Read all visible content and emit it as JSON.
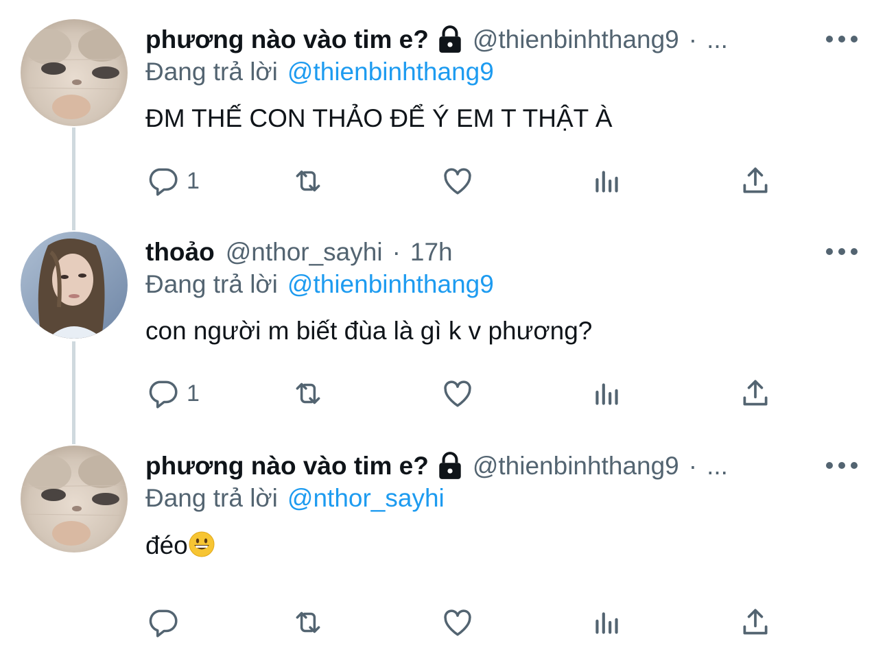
{
  "thread": [
    {
      "author_name": "phương nào vào tim e?",
      "protected": true,
      "handle": "@thienbinhthang9",
      "separator": "·",
      "time": "...",
      "reply_prefix": "Đang trả lời",
      "reply_mention": "@thienbinhthang9",
      "text": "ĐM THẾ CON THẢO ĐỂ Ý EM T THẬT À",
      "emoji": "",
      "reply_count": "1",
      "avatar": "cat-avatar"
    },
    {
      "author_name": "thoảo",
      "protected": false,
      "handle": "@nthor_sayhi",
      "separator": "·",
      "time": "17h",
      "reply_prefix": "Đang trả lời",
      "reply_mention": "@thienbinhthang9",
      "text": "con người m biết đùa là gì k v phương?",
      "emoji": "",
      "reply_count": "1",
      "avatar": "woman-avatar"
    },
    {
      "author_name": "phương nào vào tim e?",
      "protected": true,
      "handle": "@thienbinhthang9",
      "separator": "·",
      "time": "...",
      "reply_prefix": "Đang trả lời",
      "reply_mention": "@nthor_sayhi",
      "text": "đéo",
      "emoji": "grinning-face-emoji",
      "reply_count": "",
      "avatar": "cat-avatar"
    }
  ],
  "colors": {
    "text_primary": "#0f1419",
    "text_secondary": "#536471",
    "link": "#1d9bf0",
    "thread_line": "#cfd9de"
  },
  "icons": [
    "reply-icon",
    "retweet-icon",
    "like-icon",
    "views-icon",
    "share-icon",
    "more-icon",
    "lock-icon"
  ]
}
